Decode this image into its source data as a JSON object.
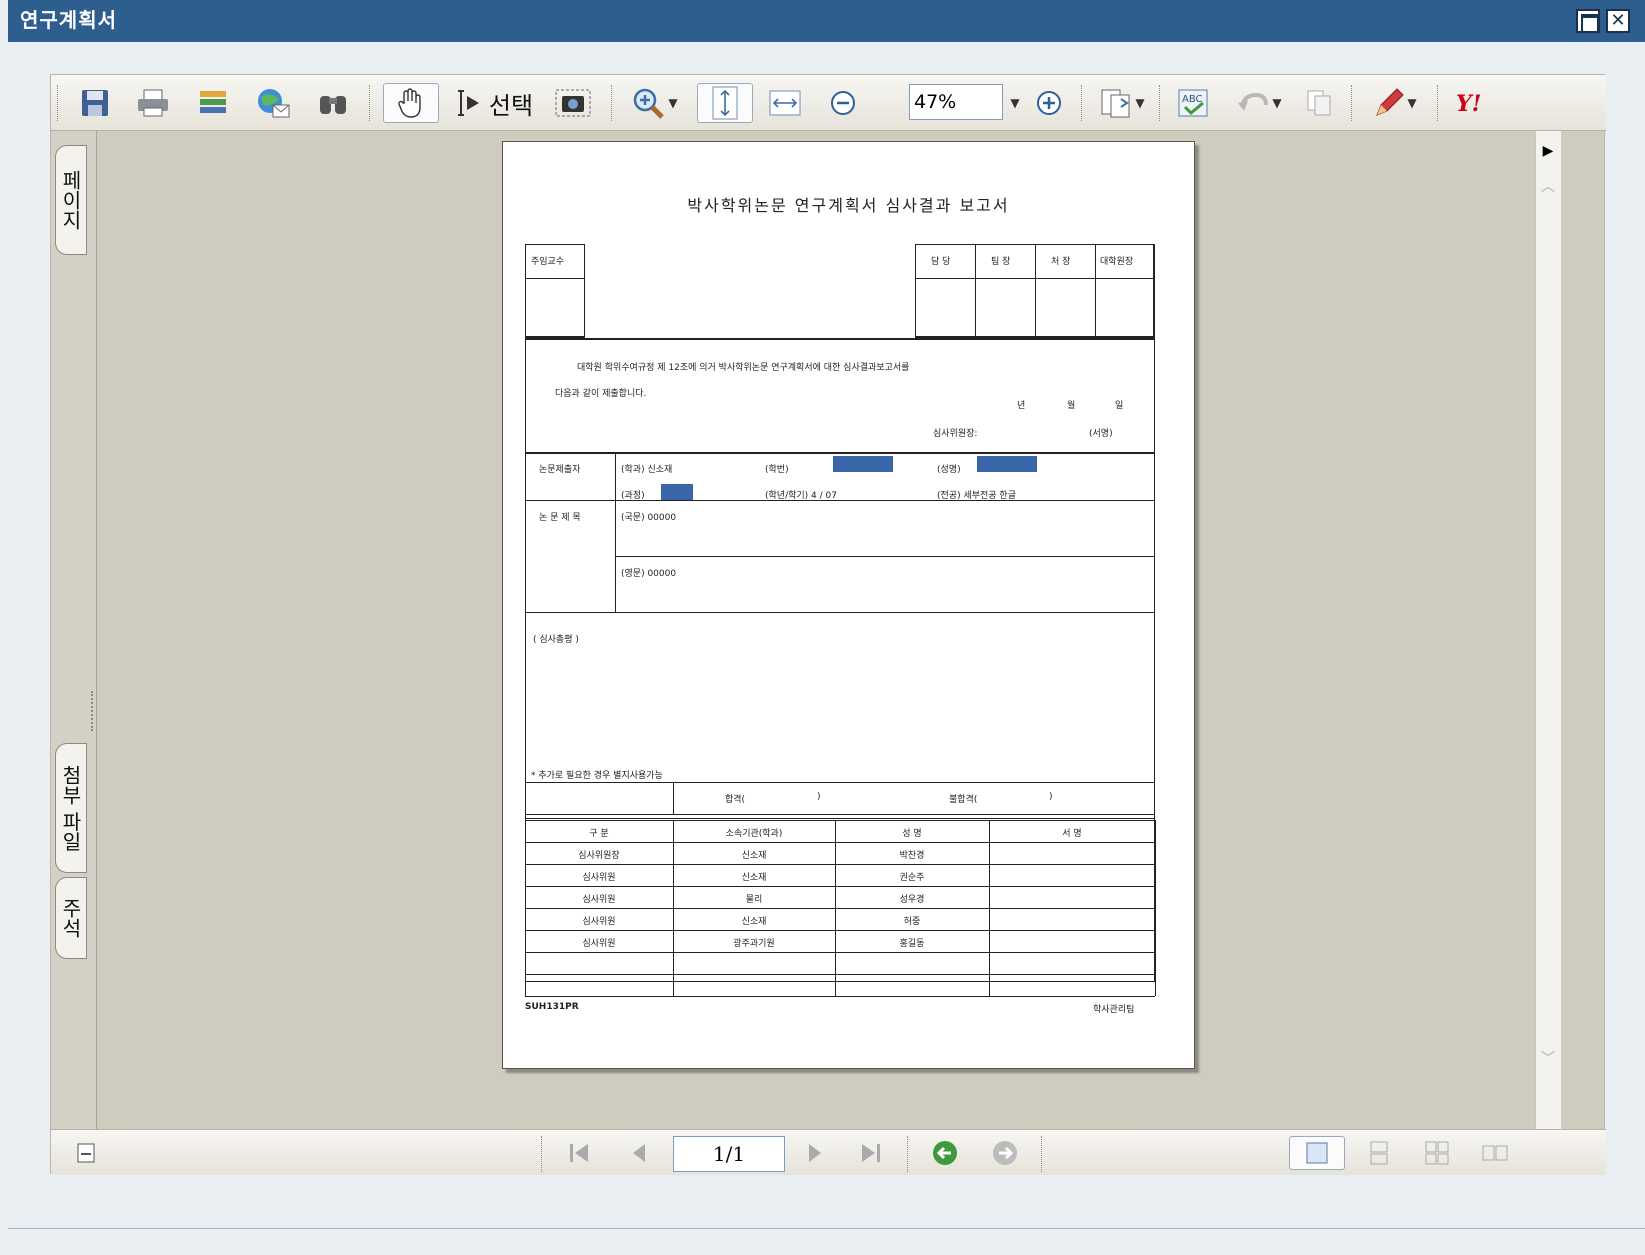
{
  "window": {
    "title": "연구계획서"
  },
  "toolbar": {
    "select_label": "선택",
    "zoom_value": "47%"
  },
  "sidebar": {
    "tab_pages": "페이지",
    "tab_attachments": "첨부 파일",
    "tab_comments": "주석"
  },
  "document": {
    "title": "박사학위논문 연구계획서 심사결과 보고서",
    "approvals": {
      "advisor": "주임교수",
      "staff": "담 당",
      "team_lead": "팀 장",
      "director": "처 장",
      "dean": "대학원장"
    },
    "intro_line1": "대학원 학위수여규정 제 12조에 의거 박사학위논문 연구계획서에 대한 심사결과보고서를",
    "intro_line2": "다음과 같이 제출합니다.",
    "date_labels": {
      "year": "년",
      "month": "월",
      "day": "일"
    },
    "chair_label": "심사위원장:",
    "sign_label": "(서명)",
    "submitter_label": "논문제출자",
    "dept_label": "(학과) 신소재",
    "student_no_label": "(학번)",
    "name_label": "(성명)",
    "course_label": "(과정)",
    "year_semester": "(학년/학기)  4 / 07",
    "major": "(전공) 세부전공 한글",
    "thesis_title_label": "논 문 제 목",
    "korean_title": "(국문)  00000",
    "english_title": "(영문)  00000",
    "review_opinion_label": "( 심사총평 )",
    "note": "* 추가로 필요한 경우 별지사용가능",
    "pass_label": "합격(",
    "pass_close": ")",
    "fail_label": "불합격(",
    "fail_close": ")",
    "committee_headers": [
      "구 분",
      "소속기관(학과)",
      "성 명",
      "서 명"
    ],
    "committee_rows": [
      [
        "심사위원장",
        "신소재",
        "박찬경",
        ""
      ],
      [
        "심사위원",
        "신소재",
        "권순주",
        ""
      ],
      [
        "심사위원",
        "물리",
        "성우경",
        ""
      ],
      [
        "심사위원",
        "신소재",
        "허중",
        ""
      ],
      [
        "심사위원",
        "광주과기원",
        "홍길동",
        ""
      ],
      [
        "",
        "",
        "",
        ""
      ],
      [
        "",
        "",
        "",
        ""
      ]
    ],
    "footer_code": "SUH131PR",
    "footer_office": "학사관리팀"
  },
  "navigation": {
    "page_indicator": "1/1"
  },
  "icons": {
    "save": "save-icon",
    "print": "print-icon",
    "export": "export-icon",
    "email": "email-icon",
    "find": "binoculars-icon",
    "hand": "hand-tool-icon",
    "select": "text-select-icon",
    "snapshot": "camera-icon"
  }
}
